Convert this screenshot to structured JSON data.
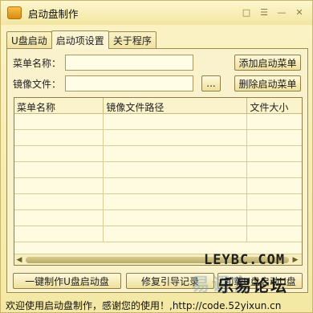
{
  "window": {
    "title": "启动盘制作"
  },
  "tabs": [
    {
      "label": "U盘启动"
    },
    {
      "label": "启动项设置"
    },
    {
      "label": "关于程序"
    }
  ],
  "form": {
    "menu_name_label": "菜单名称：",
    "menu_name_value": "",
    "image_file_label": "镜像文件：",
    "image_file_value": "",
    "browse_button": "...",
    "add_menu_button": "添加启动菜单",
    "delete_menu_button": "删除启动菜单"
  },
  "table": {
    "columns": [
      "菜单名称",
      "镜像文件路径",
      "文件大小"
    ],
    "rows": []
  },
  "buttons": {
    "make_usb": "一键制作U盘启动盘",
    "repair_boot": "修复引导记录",
    "remove_boot": "卸载U盘启动U盘"
  },
  "status": {
    "text": "欢迎使用启动盘制作，感谢您的使用！,http://code.52yixun.cn"
  },
  "watermark": {
    "line1": "LEYBC.COM",
    "line2": "乐易论坛",
    "faded": "易语言"
  },
  "colors": {
    "background": "#f6ecb0",
    "border": "#9c8c52"
  }
}
